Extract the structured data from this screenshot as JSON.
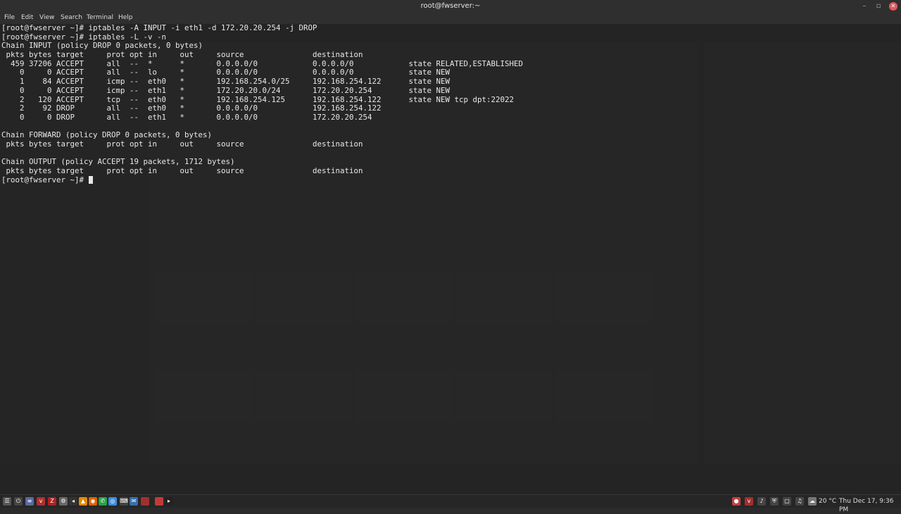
{
  "window": {
    "title": "root@fwserver:~",
    "controls": {
      "minimize": "–",
      "maximize": "▫",
      "close": "✕"
    }
  },
  "menu": [
    "File",
    "Edit",
    "View",
    "Search",
    "Terminal",
    "Help"
  ],
  "terminal_lines": [
    "[root@fwserver ~]# iptables -A INPUT -i eth1 -d 172.20.20.254 -j DROP",
    "[root@fwserver ~]# iptables -L -v -n",
    "Chain INPUT (policy DROP 0 packets, 0 bytes)",
    " pkts bytes target     prot opt in     out     source               destination",
    "  459 37206 ACCEPT     all  --  *      *       0.0.0.0/0            0.0.0.0/0            state RELATED,ESTABLISHED",
    "    0     0 ACCEPT     all  --  lo     *       0.0.0.0/0            0.0.0.0/0            state NEW",
    "    1    84 ACCEPT     icmp --  eth0   *       192.168.254.0/25     192.168.254.122      state NEW",
    "    0     0 ACCEPT     icmp --  eth1   *       172.20.20.0/24       172.20.20.254        state NEW",
    "    2   120 ACCEPT     tcp  --  eth0   *       192.168.254.125      192.168.254.122      state NEW tcp dpt:22022",
    "    2    92 DROP       all  --  eth0   *       0.0.0.0/0            192.168.254.122",
    "    0     0 DROP       all  --  eth1   *       0.0.0.0/0            172.20.20.254",
    "",
    "Chain FORWARD (policy DROP 0 packets, 0 bytes)",
    " pkts bytes target     prot opt in     out     source               destination",
    "",
    "Chain OUTPUT (policy ACCEPT 19 packets, 1712 bytes)",
    " pkts bytes target     prot opt in     out     source               destination"
  ],
  "prompt": "[root@fwserver ~]# ",
  "taskbar": {
    "launchers": [
      "menu-icon",
      "power-icon",
      "settings-icon",
      "files-icon",
      "vm-icon",
      "filezilla-icon",
      "system-icon",
      "back-icon",
      "vlc-icon",
      "browser-icon",
      "whatsapp-icon",
      "chrome-icon",
      "email-icon",
      "keyboard-icon",
      "app-icon",
      "app-icon",
      "files-icon",
      "terminal-icon"
    ],
    "clock": "Thu Dec 17,  9:36 PM",
    "weather": "20 °C"
  }
}
